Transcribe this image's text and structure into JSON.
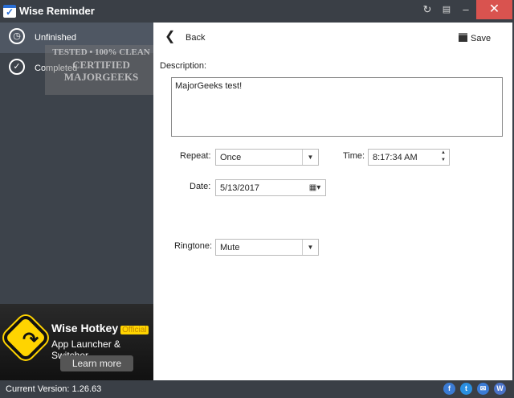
{
  "window": {
    "title": "Wise Reminder"
  },
  "sidebar": {
    "items": [
      {
        "label": "Unfinished"
      },
      {
        "label": "Completed"
      }
    ]
  },
  "watermark": {
    "lines": [
      "TESTED • 100% CLEAN",
      "CERTIFIED",
      "MAJORGEEKS"
    ]
  },
  "ad": {
    "title": "Wise Hotkey",
    "badge": "Official",
    "subtitle": "App Launcher & Switcher",
    "button": "Learn more"
  },
  "main": {
    "back_label": "Back",
    "save_label": "Save",
    "description_label": "Description:",
    "description_value": "MajorGeeks test!",
    "repeat_label": "Repeat:",
    "repeat_value": "Once",
    "time_label": "Time:",
    "time_value": "8:17:34 AM",
    "date_label": "Date:",
    "date_value": "5/13/2017",
    "ringtone_label": "Ringtone:",
    "ringtone_value": "Mute"
  },
  "footer": {
    "version": "Current Version: 1.26.63",
    "social": [
      "f",
      "t",
      "✉",
      "W"
    ]
  }
}
